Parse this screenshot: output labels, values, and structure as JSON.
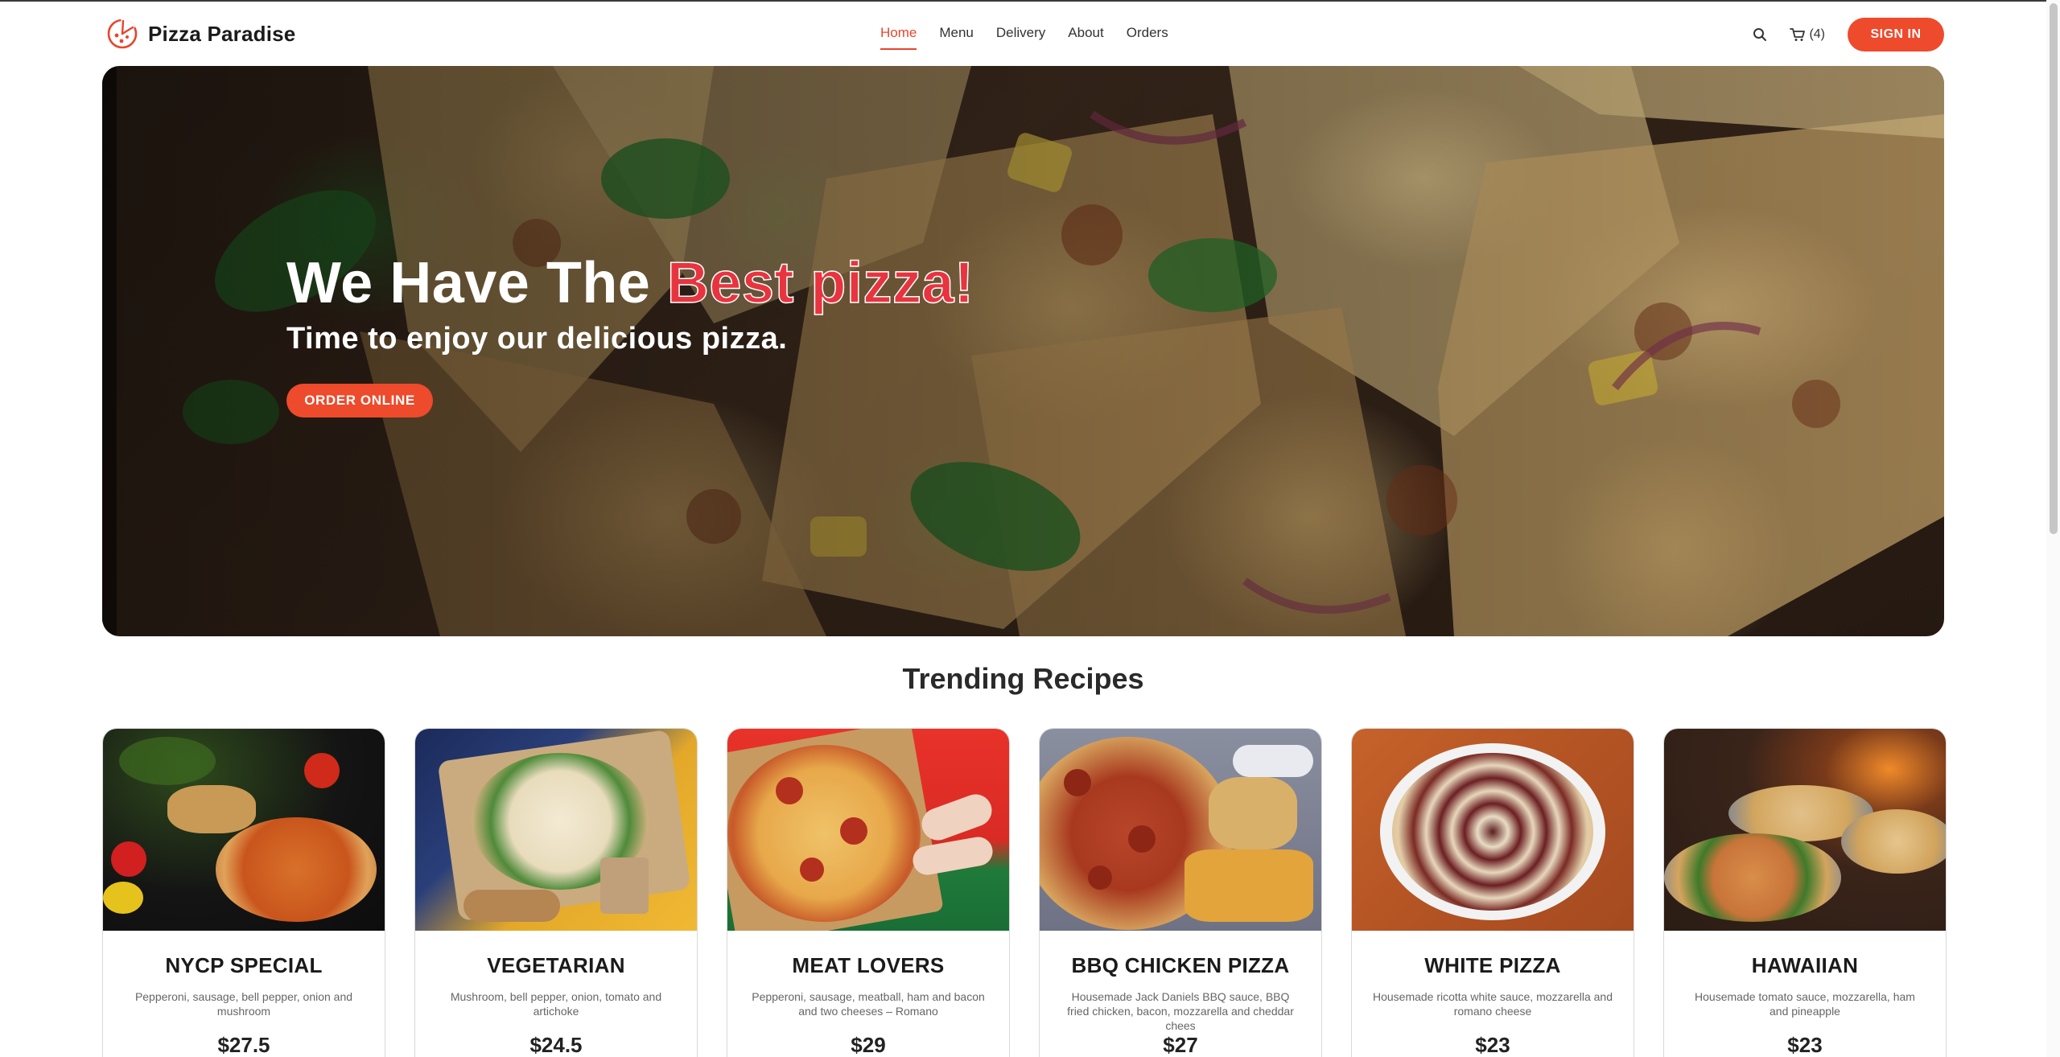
{
  "brand": {
    "name": "Pizza Paradise",
    "logo_icon": "pizza-slice-icon"
  },
  "nav": {
    "items": [
      {
        "label": "Home",
        "active": true
      },
      {
        "label": "Menu",
        "active": false
      },
      {
        "label": "Delivery",
        "active": false
      },
      {
        "label": "About",
        "active": false
      },
      {
        "label": "Orders",
        "active": false
      }
    ]
  },
  "header": {
    "search_icon": "search-icon",
    "cart_icon": "cart-icon",
    "cart_count": "(4)",
    "signin_label": "SIGN IN"
  },
  "hero": {
    "title_prefix": "We Have The",
    "title_accent": "Best pizza!",
    "subtitle": "Time to enjoy our delicious pizza.",
    "cta_label": "ORDER ONLINE"
  },
  "trending": {
    "title": "Trending Recipes",
    "items": [
      {
        "name": "NYCP SPECIAL",
        "description": "Pepperoni, sausage, bell pepper, onion and mushroom",
        "price": "$27.5"
      },
      {
        "name": "VEGETARIAN",
        "description": "Mushroom, bell pepper, onion, tomato and artichoke",
        "price": "$24.5"
      },
      {
        "name": "MEAT LOVERS",
        "description": "Pepperoni, sausage, meatball, ham and bacon and two cheeses – Romano",
        "price": "$29"
      },
      {
        "name": "BBQ CHICKEN PIZZA",
        "description": "Housemade Jack Daniels BBQ sauce, BBQ fried chicken, bacon, mozzarella and cheddar chees",
        "price": "$27"
      },
      {
        "name": "WHITE PIZZA",
        "description": "Housemade ricotta white sauce, mozzarella and romano cheese",
        "price": "$23"
      },
      {
        "name": "HAWAIIAN",
        "description": "Housemade tomato sauce, mozzarella, ham and pineapple",
        "price": "$23"
      }
    ]
  },
  "colors": {
    "accent": "#ee4a2c",
    "nav_active": "#e8452c",
    "hero_accent": "#e8343f"
  }
}
